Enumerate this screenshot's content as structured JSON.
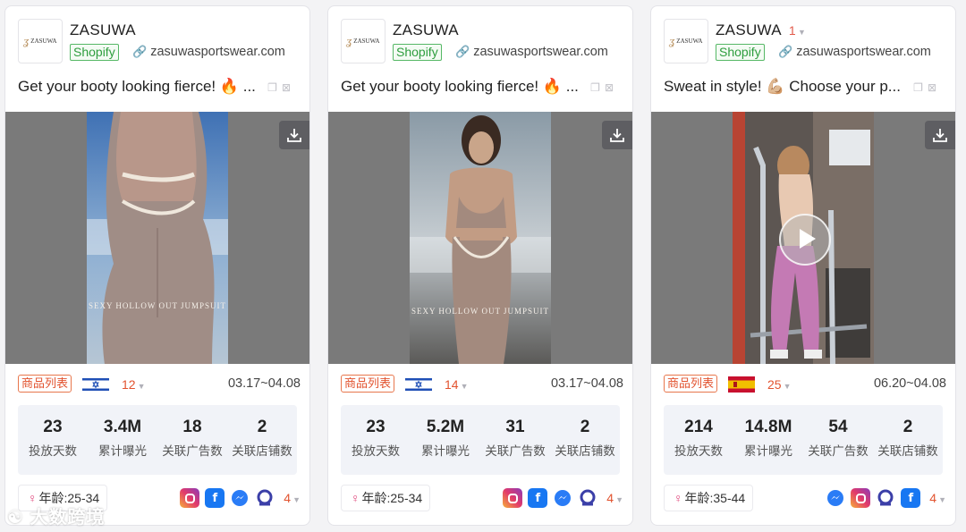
{
  "cards": [
    {
      "brand": "ZASUWA",
      "brand_count": "",
      "platform": "Shopify",
      "site": "zasuwasportswear.com",
      "desc": "Get your booty looking fierce! 🔥 ...",
      "overlay": "SEXY HOLLOW OUT JUMPSUIT",
      "tag": "商品列表",
      "flag": "israel-flag",
      "count": "12",
      "dates": "03.17~04.08",
      "stats": [
        {
          "v": "23",
          "l": "投放天数"
        },
        {
          "v": "3.4M",
          "l": "累计曝光"
        },
        {
          "v": "18",
          "l": "关联广告数"
        },
        {
          "v": "2",
          "l": "关联店铺数"
        }
      ],
      "age": "年龄:25-34",
      "platforms_count": "4",
      "video": false
    },
    {
      "brand": "ZASUWA",
      "brand_count": "",
      "platform": "Shopify",
      "site": "zasuwasportswear.com",
      "desc": "Get your booty looking fierce! 🔥 ...",
      "overlay": "SEXY HOLLOW OUT JUMPSUIT",
      "tag": "商品列表",
      "flag": "israel-flag",
      "count": "14",
      "dates": "03.17~04.08",
      "stats": [
        {
          "v": "23",
          "l": "投放天数"
        },
        {
          "v": "5.2M",
          "l": "累计曝光"
        },
        {
          "v": "31",
          "l": "关联广告数"
        },
        {
          "v": "2",
          "l": "关联店铺数"
        }
      ],
      "age": "年龄:25-34",
      "platforms_count": "4",
      "video": false
    },
    {
      "brand": "ZASUWA",
      "brand_count": "1",
      "platform": "Shopify",
      "site": "zasuwasportswear.com",
      "desc": "Sweat in style! 💪🏼 Choose your p...",
      "overlay": "",
      "tag": "商品列表",
      "flag": "spain-flag",
      "count": "25",
      "dates": "06.20~04.08",
      "stats": [
        {
          "v": "214",
          "l": "投放天数"
        },
        {
          "v": "14.8M",
          "l": "累计曝光"
        },
        {
          "v": "54",
          "l": "关联广告数"
        },
        {
          "v": "2",
          "l": "关联店铺数"
        }
      ],
      "age": "年龄:35-44",
      "platforms_count": "4",
      "video": true
    }
  ],
  "logo_text": "ZASUWA",
  "watermark": "大数跨境",
  "colors": {
    "accent": "#e2532f",
    "shopify": "#2f9e3f",
    "facebook": "#1877f2"
  }
}
